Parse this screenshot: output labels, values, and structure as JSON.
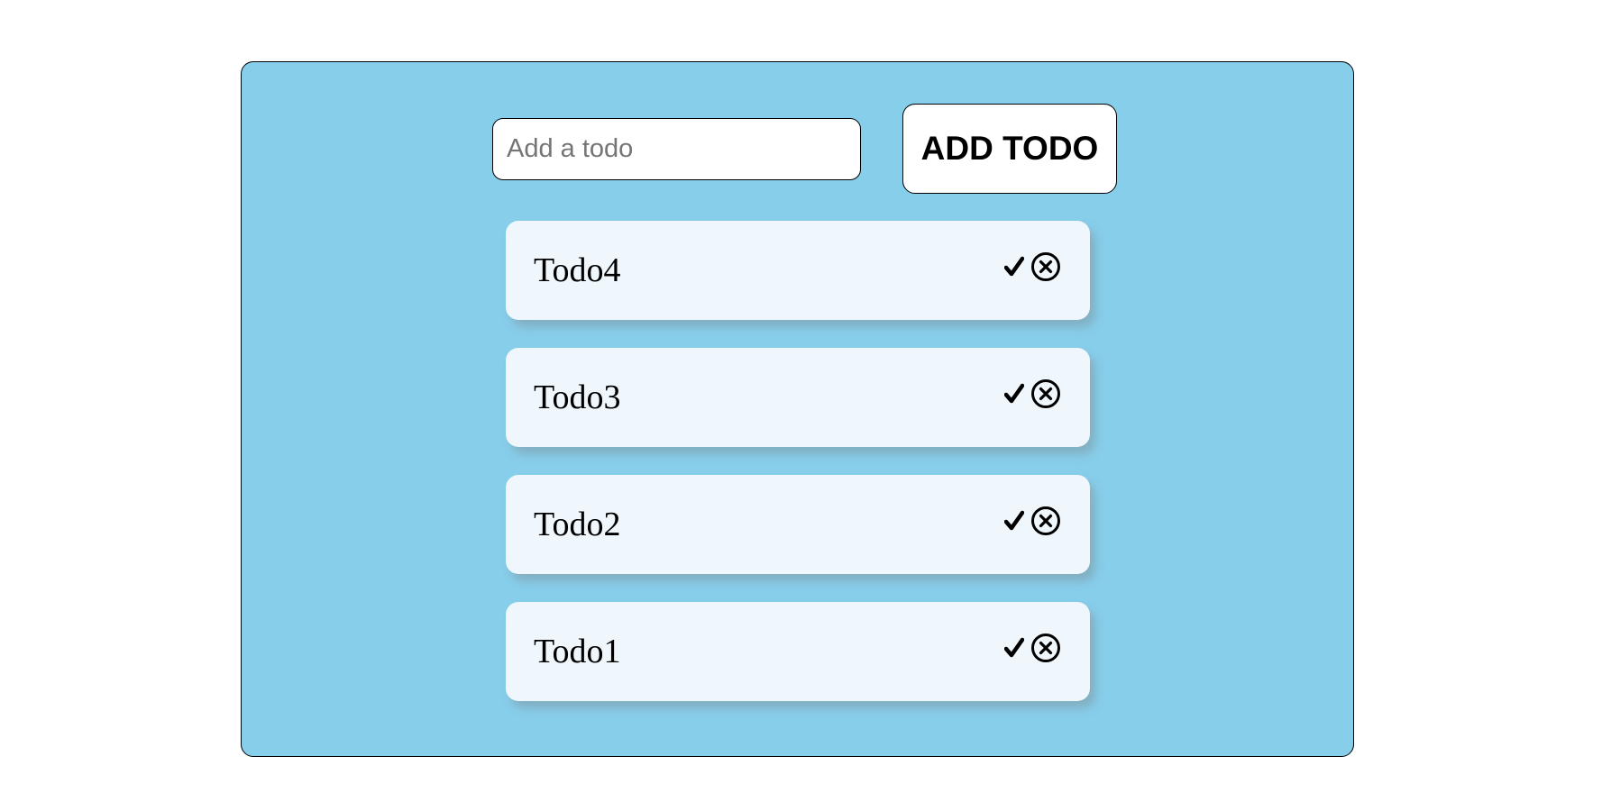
{
  "form": {
    "input_placeholder": "Add a todo",
    "input_value": "",
    "add_button_label": "ADD TODO"
  },
  "todos": [
    {
      "text": "Todo4",
      "complete_icon": "check-icon",
      "delete_icon": "circle-x-icon"
    },
    {
      "text": "Todo3",
      "complete_icon": "check-icon",
      "delete_icon": "circle-x-icon"
    },
    {
      "text": "Todo2",
      "complete_icon": "check-icon",
      "delete_icon": "circle-x-icon"
    },
    {
      "text": "Todo1",
      "complete_icon": "check-icon",
      "delete_icon": "circle-x-icon"
    }
  ],
  "colors": {
    "panel_background": "#87ceeb",
    "todo_background": "#eff7fc",
    "button_background": "#ffffff"
  }
}
